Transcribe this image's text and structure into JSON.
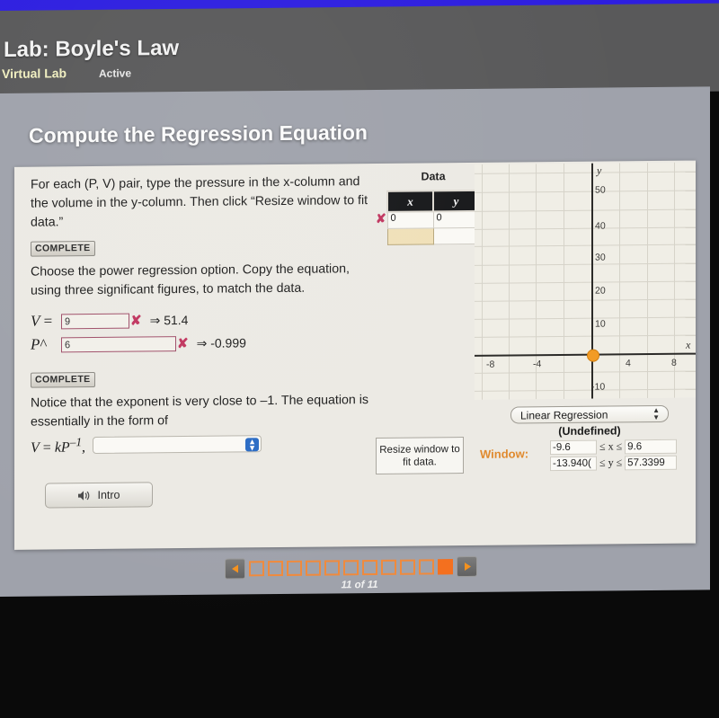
{
  "header": {
    "lab_title": "Lab: Boyle's Law",
    "category": "Virtual Lab",
    "status": "Active"
  },
  "activity": {
    "title": "Compute the Regression Equation"
  },
  "instructions": {
    "step1_text": "For each (P, V) pair, type the pressure in the x-column and the volume in the y-column. Then click “Resize window to fit data.”",
    "step1_badge": "COMPLETE",
    "step2_text": "Choose the power regression option. Copy the equation, using three significant figures, to match the data.",
    "step3_badge": "COMPLETE",
    "step3_text": "Notice that the exponent is very close to –1. The equation is essentially in the form of"
  },
  "equation": {
    "v_label": "V =",
    "v_value": "9",
    "v_mark": "✘",
    "v_result": "⇒ 51.4",
    "p_label": "P^",
    "p_value": "6",
    "p_mark": "✘",
    "p_result": "⇒ -0.999",
    "form_eq": "V = kP",
    "form_exp": "–1",
    "form_comma": ",",
    "form_select_value": ""
  },
  "data_table": {
    "title": "Data",
    "columns": [
      "x",
      "y"
    ],
    "row_marker": "✘",
    "rows": [
      [
        "0",
        "0"
      ],
      [
        "",
        ""
      ]
    ]
  },
  "controls": {
    "resize_button": "Resize window to fit data.",
    "window_label": "Window:",
    "regression_option": "Linear Regression",
    "regression_result": "(Undefined)",
    "window_xmin": "-9.6",
    "window_xmax": "9.6",
    "window_ymin": "-13.940(",
    "window_ymax": "57.3399",
    "x_relation": "≤ x ≤",
    "y_relation": "≤ y ≤"
  },
  "graph": {
    "x_axis_label": "x",
    "y_axis_label": "y",
    "x_ticks": [
      "-8",
      "-4",
      "4",
      "8"
    ],
    "y_ticks": [
      "50",
      "40",
      "30",
      "20",
      "10",
      "-10"
    ],
    "origin_point_color": "#f29b25"
  },
  "footer": {
    "intro_button": "Intro",
    "intro_icon": "speaker-icon",
    "page_count_label": "11 of 11",
    "total_pages": 11,
    "current_page": 11,
    "prev_label": "◀",
    "next_label": "▶"
  },
  "chart_data": {
    "type": "scatter",
    "title": "",
    "xlabel": "x",
    "ylabel": "y",
    "xlim": [
      -9.6,
      9.6
    ],
    "ylim": [
      -13.94,
      57.3399
    ],
    "x_ticks": [
      -8,
      -4,
      4,
      8
    ],
    "y_ticks": [
      50,
      40,
      30,
      20,
      10,
      -10
    ],
    "grid": true,
    "series": [
      {
        "name": "data",
        "x": [
          0
        ],
        "y": [
          0
        ],
        "color": "#f29b25"
      }
    ],
    "regression": {
      "type": "Linear Regression",
      "result": "(Undefined)"
    }
  }
}
